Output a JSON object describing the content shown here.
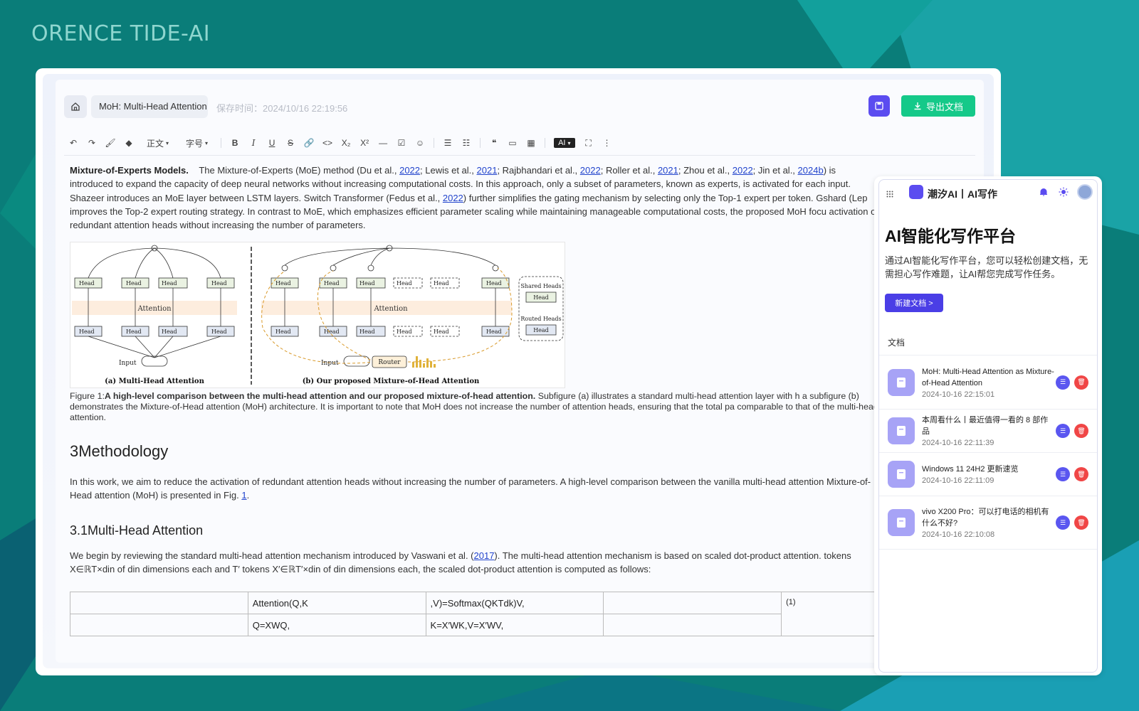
{
  "brand": "ORENCE TIDE-AI",
  "editor": {
    "doc_title": "MoH: Multi-Head Attention as Mixture-of-Head Attention",
    "save_time": "保存时间：2024/10/16 22:19:56",
    "export_label": "导出文档",
    "toolbar": {
      "paragraph_style": "正文",
      "font_size": "字号",
      "ai_label": "AI"
    }
  },
  "doc": {
    "moe_heading": "Mixture-of-Experts Models.",
    "moe_text_1": "The Mixture-of-Experts (MoE) method (Du et al.,",
    "ref_2022a": "2022",
    "sep1": "; Lewis et al.,",
    "ref_2021a": "2021",
    "sep2": "; Rajbhandari et al.,",
    "ref_2022b": "2022",
    "sep3": "; Roller et al.,",
    "ref_2021b": "2021",
    "sep4": "; Zhou et al.,",
    "ref_2022c": "2022",
    "sep5": "; Jin et al.,",
    "ref_2024b": "2024b",
    "moe_text_2": ") is introduced to expand the capacity of deep neural networks without increasing computational costs. In this approach, only a subset of parameters, known as experts, is activated for each input. Shazeer introduces an MoE layer between LSTM layers. Switch Transformer (Fedus et al.,",
    "ref_2022d": "2022",
    "moe_text_3": ") further simplifies the gating mechanism by selecting only the Top-1 expert per token. Gshard (Lep improves the Top-2 expert routing strategy. In contrast to MoE, which emphasizes efficient parameter scaling while maintaining manageable computational costs, the proposed MoH focu activation of redundant attention heads without increasing the number of parameters.",
    "figure": {
      "caption_a": "(a) Multi-Head Attention",
      "caption_b": "(b) Our proposed Mixture-of-Head Attention",
      "attention_label": "Attention",
      "input_label": "Input",
      "router_label": "Router",
      "shared_heads": "Shared Heads",
      "routed_heads": "Routed Heads",
      "head_label": "Head"
    },
    "caption_prefix": "Figure 1:",
    "caption_bold": "A high-level comparison between the multi-head attention and our proposed mixture-of-head attention.",
    "caption_rest": " Subfigure (a) illustrates a standard multi-head attention layer with h a subfigure (b) demonstrates the Mixture-of-Head attention (MoH) architecture. It is important to note that MoH does not increase the number of attention heads, ensuring that the total pa comparable to that of the multi-head attention.",
    "h2": "3Methodology",
    "p2_text": "In this work, we aim to reduce the activation of redundant attention heads without increasing the number of parameters. A high-level comparison between the vanilla multi-head attention Mixture-of-Head attention (MoH) is presented in Fig.",
    "p2_ref": "1",
    "h3": "3.1Multi-Head Attention",
    "p3_text_1": "We begin by reviewing the standard multi-head attention mechanism introduced by Vaswani et al. (",
    "p3_ref": "2017",
    "p3_text_2": "). The multi-head attention mechanism is based on scaled dot-product attention. tokens X∈ℝT×din of din dimensions each and T′ tokens X′∈ℝT′×din of din dimensions each, the scaled dot-product attention is computed as follows:",
    "eq": {
      "r1c2": "Attention(Q,K",
      "r1c3": ",V)=Softmax(QKTdk)V,",
      "r1c5": "(1)",
      "r2c2": "Q=XWQ,",
      "r2c3": "K=X′WK,V=X′WV,"
    }
  },
  "panel": {
    "brand": "潮汐AI丨AI写作",
    "heading": "AI智能化写作平台",
    "description": "通过AI智能化写作平台，您可以轻松创建文档，无需担心写作难题，让AI帮您完成写作任务。",
    "new_doc_label": "新建文档 >",
    "section_label": "文档",
    "documents": [
      {
        "title": "MoH: Multi-Head Attention as Mixture-of-Head Attention",
        "date": "2024-10-16 22:15:01"
      },
      {
        "title": "本周看什么丨最近值得一看的 8 部作品",
        "date": "2024-10-16 22:11:39"
      },
      {
        "title": "Windows 11 24H2 更新速览",
        "date": "2024-10-16 22:11:09"
      },
      {
        "title": "vivo X200 Pro：可以打电话的相机有什么不好?",
        "date": "2024-10-16 22:10:08"
      }
    ]
  },
  "colors": {
    "background": "#0a7d79",
    "accent_purple": "#5b4cf0",
    "export_green": "#15c989",
    "delete_red": "#f04646"
  }
}
